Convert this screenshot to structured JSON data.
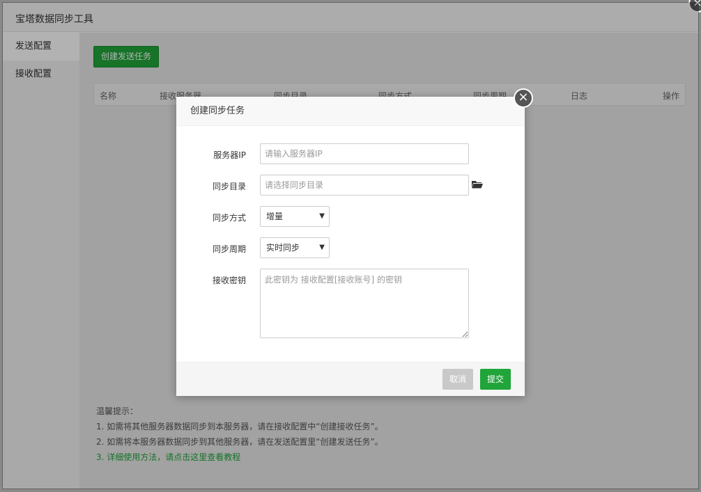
{
  "window": {
    "title": "宝塔数据同步工具",
    "close_icon": "×"
  },
  "sidebar": {
    "items": [
      {
        "label": "发送配置",
        "active": true
      },
      {
        "label": "接收配置",
        "active": false
      }
    ]
  },
  "content": {
    "create_button": "创建发送任务",
    "table_headers": [
      "名称",
      "接收服务器",
      "同步目录",
      "同步方式",
      "同步周期",
      "日志",
      "操作"
    ],
    "tips": {
      "title": "温馨提示：",
      "line1": "1. 如需将其他服务器数据同步到本服务器，请在接收配置中“创建接收任务”。",
      "line2": "2. 如需将本服务器数据同步到其他服务器，请在发送配置里“创建发送任务”。",
      "line3_prefix": "3. ",
      "line3_link": "详细使用方法，请点击这里查看教程"
    }
  },
  "modal": {
    "title": "创建同步任务",
    "close_icon": "×",
    "fields": {
      "server_ip": {
        "label": "服务器IP",
        "placeholder": "请输入服务器IP",
        "value": ""
      },
      "sync_dir": {
        "label": "同步目录",
        "placeholder": "请选择同步目录",
        "value": "",
        "icon": "folder-open-icon"
      },
      "sync_mode": {
        "label": "同步方式",
        "selected": "增量"
      },
      "sync_period": {
        "label": "同步周期",
        "selected": "实时同步"
      },
      "secret_key": {
        "label": "接收密钥",
        "placeholder": "此密钥为 接收配置[接收账号] 的密钥",
        "value": ""
      }
    },
    "buttons": {
      "cancel": "取消",
      "submit": "提交"
    }
  },
  "colors": {
    "accent": "#20a53a",
    "cancel": "#c9c9c9",
    "overlay": "rgba(0,0,0,0.3)"
  }
}
